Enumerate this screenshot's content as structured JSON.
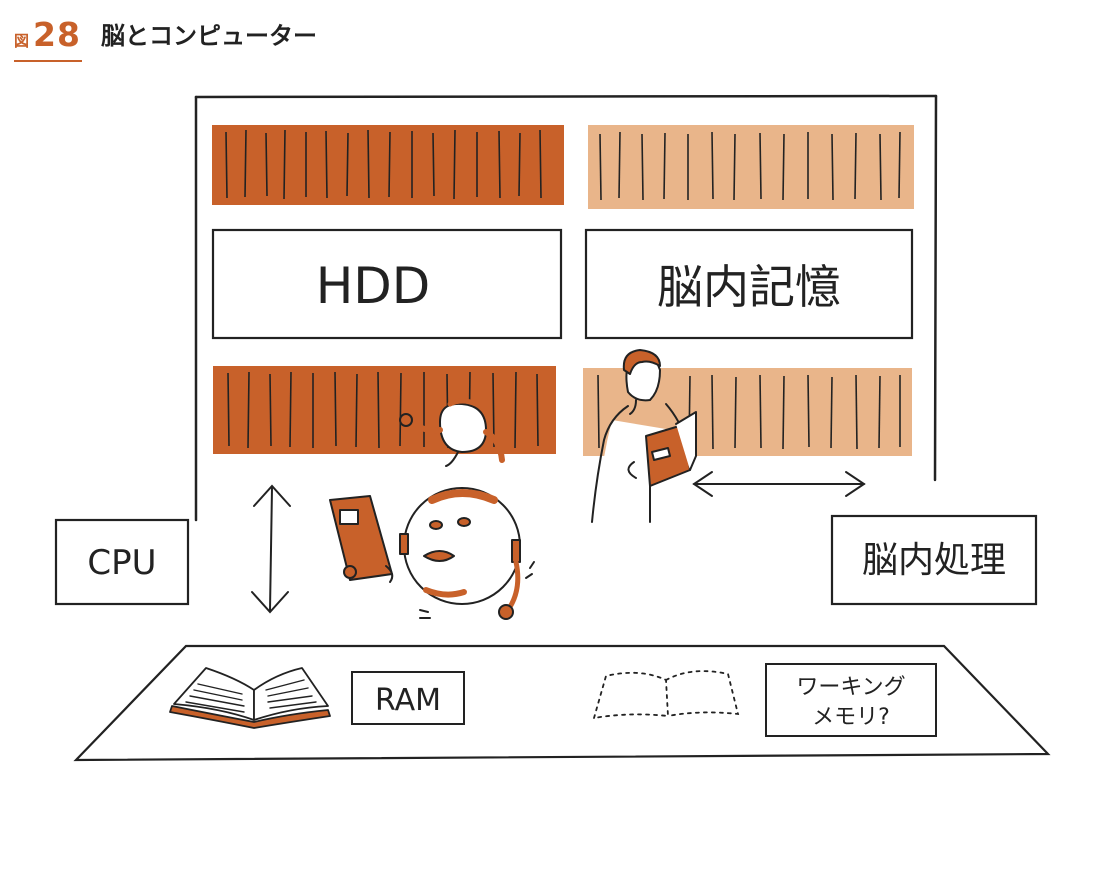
{
  "figure": {
    "label": "図",
    "number": "28",
    "title": "脳とコンピューター"
  },
  "labels": {
    "hdd": "HDD",
    "brain_memory": "脳内記憶",
    "cpu": "CPU",
    "brain_processing": "脳内処理",
    "ram": "RAM",
    "working_memory_line1": "ワーキング",
    "working_memory_line2": "メモリ?"
  },
  "colors": {
    "orange_dark": "#c8612a",
    "orange_light": "#e9b58a",
    "line": "#222222"
  }
}
